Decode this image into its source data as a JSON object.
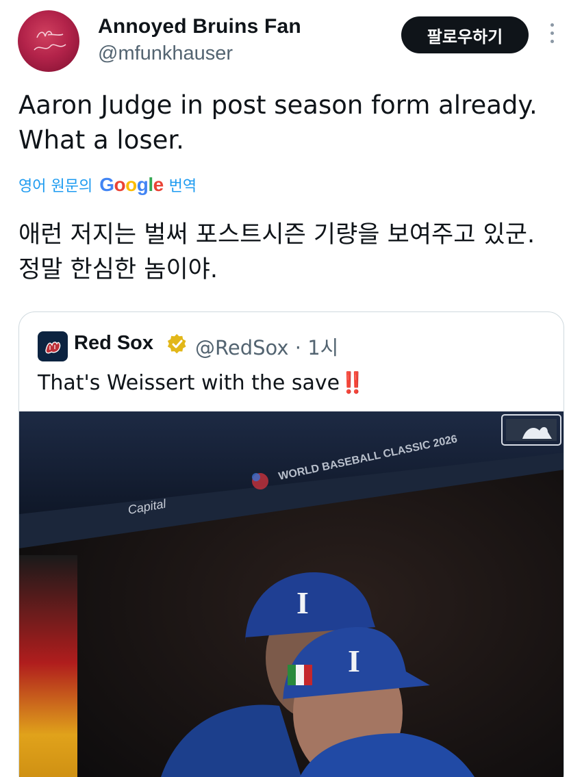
{
  "author": {
    "display_name": "Annoyed Bruins Fan",
    "handle": "@mfunkhauser",
    "avatar_icon": "signature-avatar-icon"
  },
  "follow_button": {
    "label": "팔로우하기"
  },
  "tweet": {
    "text_line1": "Aaron Judge in post season form already.",
    "text_line2": "What a loser.",
    "translate_prefix": "영어 원문의",
    "translate_brand": "Google",
    "translate_suffix": "번역",
    "translated_line1": "애런 저지는 벌써 포스트시즌 기량을 보여주고 있군.",
    "translated_line2": "정말 한심한 놈이야."
  },
  "quoted_tweet": {
    "name": "Red Sox",
    "handle": "@RedSox",
    "separator": "·",
    "time": "1시",
    "text": "That's Weissert with the save",
    "emoji": "‼️",
    "verified_color": "#e2b719",
    "media": {
      "banner_text": "WORLD BASEBALL CLASSIC 2026",
      "sponsor_text": "Capital",
      "cap_letter": "I"
    }
  },
  "colors": {
    "accent": "#1d9bf0",
    "text": "#0f1419",
    "muted": "#536471"
  }
}
